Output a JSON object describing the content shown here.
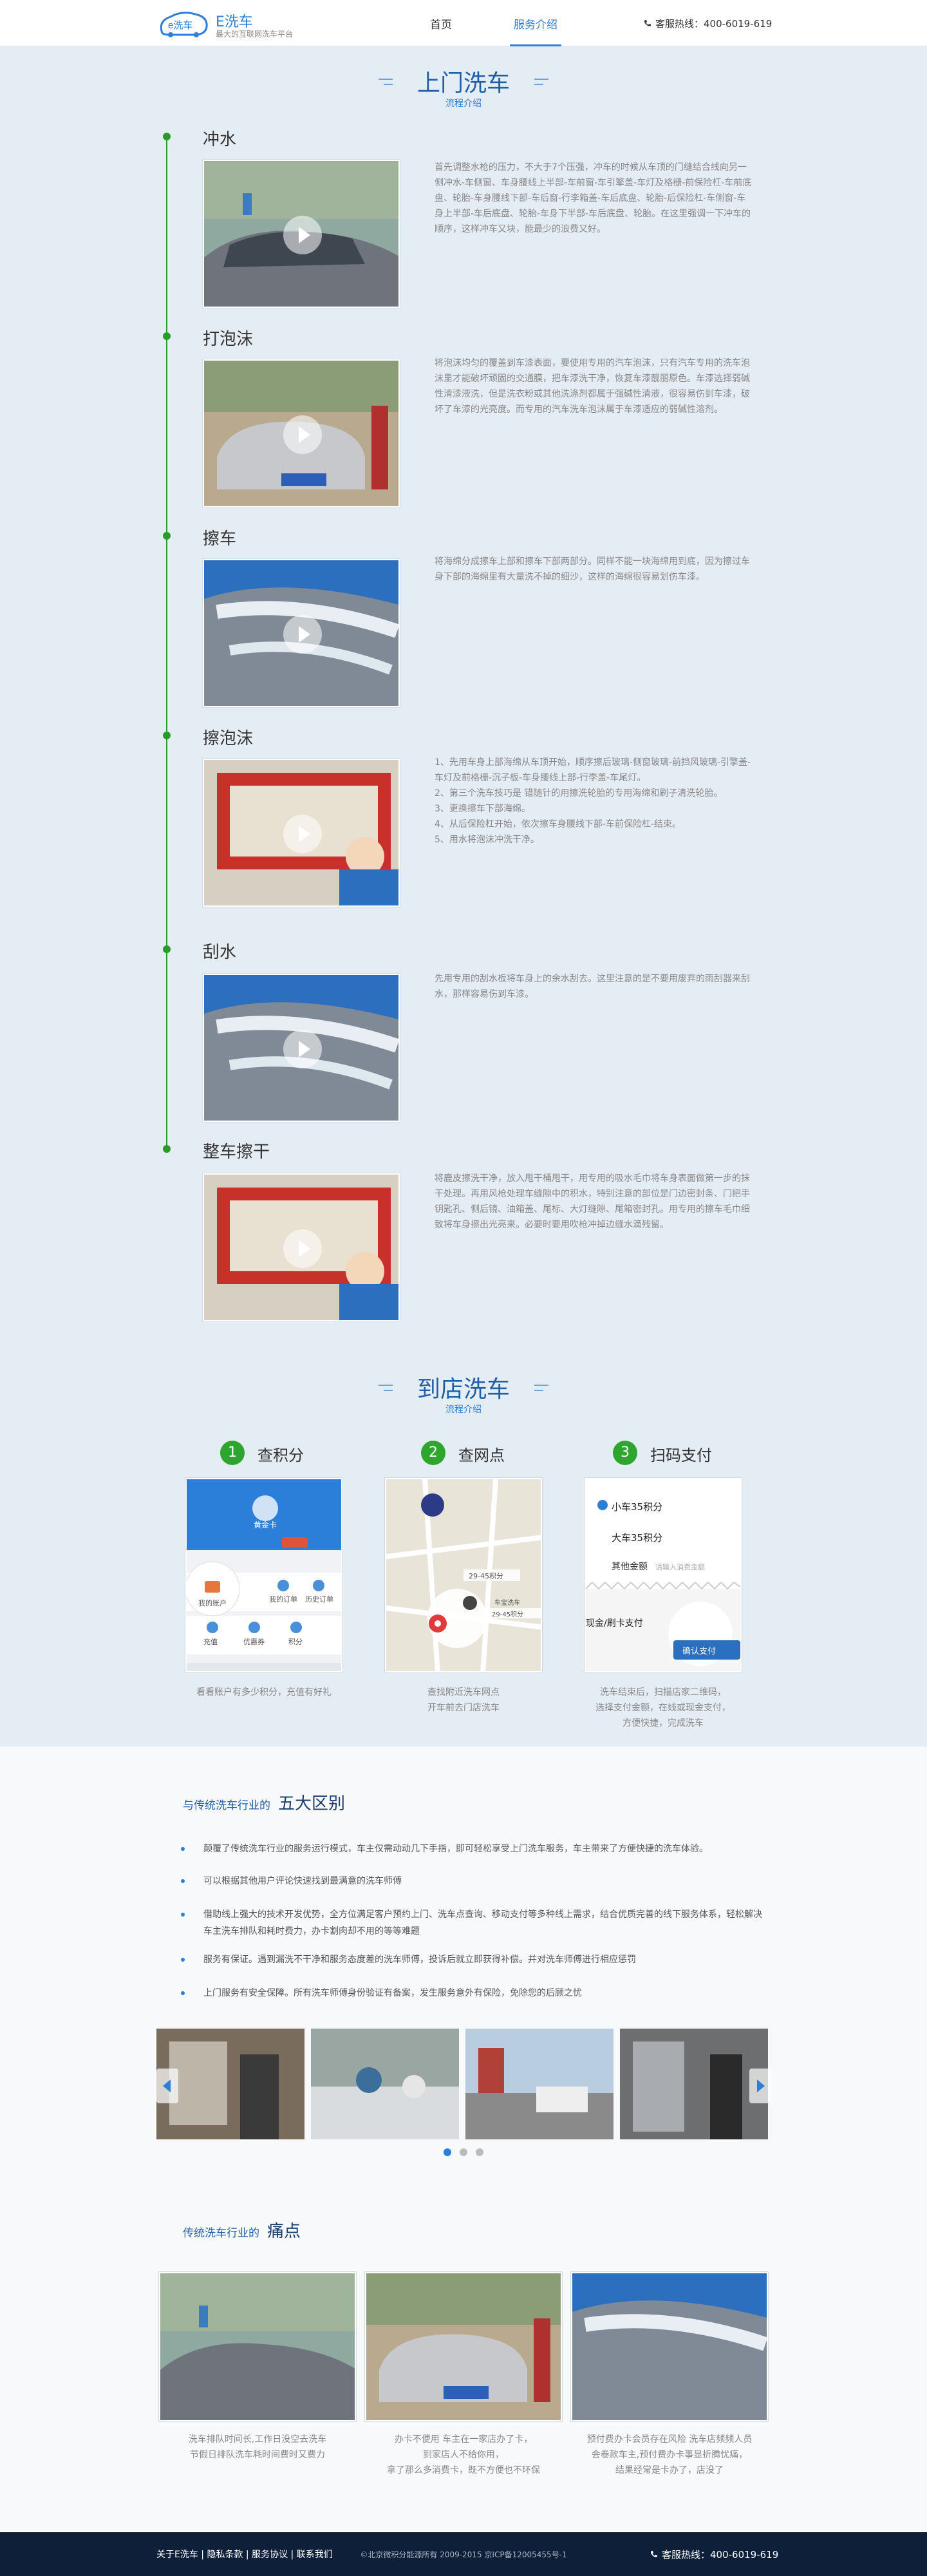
{
  "header": {
    "logo_text": "E洗车",
    "logo_mark": "e洗车",
    "logo_sub": "最大的互联网洗车平台",
    "nav_home": "首页",
    "nav_service": "服务介绍",
    "hotline": "客服热线：400-6019-619"
  },
  "door": {
    "title": "上门洗车",
    "sub": "流程介绍",
    "steps": [
      {
        "title": "冲水",
        "desc": "首先调整水枪的压力，不大于7个压强，冲车的时候从车顶的门缝结合线向另一侧冲水-车侧窗、车身腰线上半部-车前窗-车引擎盖-车灯及格栅-前保险杠-车前底盘、轮胎-车身腰线下部-车后窗-行李箱盖-车后底盘、轮胎-后保险杠-车侧窗-车身上半部-车后底盘、轮胎-车身下半部-车后底盘、轮胎。在这里强调一下冲车的顺序，这样冲车又块，能最少的浪费又好。"
      },
      {
        "title": "打泡沫",
        "desc": "将泡沫均匀的覆盖到车漆表面，要使用专用的汽车泡沫，只有汽车专用的洗车泡沫里才能破坏顽固的交通膜，把车漆洗干净，恢复车漆靓丽原色。车漆选择弱碱性清漆液洗，但是洗衣粉或其他洗涤剂都属于强碱性清液，很容易伤到车漆，破坏了车漆的光亮度。而专用的汽车洗车泡沫属于车漆适应的弱碱性溶剂。"
      },
      {
        "title": "擦车",
        "desc": "将海绵分成擦车上部和擦车下部两部分。同样不能一块海绵用到底，因为擦过车身下部的海绵里有大量洗不掉的细沙，这样的海绵很容易划伤车漆。"
      },
      {
        "title": "擦泡沫",
        "desc": "1、先用车身上部海绵从车顶开始，顺序擦后玻璃-侧窗玻璃-前挡风玻璃-引擎盖-车灯及前格栅-沉子板-车身腰线上部-行李盖-车尾灯。\n2、第三个洗车技巧是 错随针的用擦洗轮胎的专用海绵和刷子清洗轮胎。\n3、更换擦车下部海绵。\n4、从后保险杠开始，依次擦车身腰线下部-车前保险杠-结束。\n5、用水将泡沫冲洗干净。"
      },
      {
        "title": "刮水",
        "desc": "先用专用的刮水板将车身上的余水刮去。这里注意的是不要用废弃的雨刮器来刮水，那样容易伤到车漆。"
      },
      {
        "title": "整车擦干",
        "desc": "将鹿皮擦洗干净，放入甩干桶甩干，用专用的吸水毛巾将车身表面做第一步的抹干处理。再用风枪处理车缝隙中的积水，特别注意的部位是门边密封条、门把手钥匙孔、侧后镜、油箱盖、尾标、大灯缝隙、尾箱密封孔。用专用的擦车毛巾细致将车身擦出光亮来。必要时要用吹枪冲掉边缝水滴残留。"
      }
    ]
  },
  "store": {
    "title": "到店洗车",
    "sub": "流程介绍",
    "cards": [
      {
        "num": "1",
        "title": "查积分",
        "cap": "看看账户有多少积分，充值有好礼",
        "tags": [
          "我的账户",
          "黄金卡",
          "我的订单",
          "历史订单",
          "充值",
          "优惠券",
          "积分"
        ]
      },
      {
        "num": "2",
        "title": "查网点",
        "cap": "查找附近洗车网点\n开车前去门店洗车",
        "tags": [
          "29-45积分",
          "29-45积分",
          "车宝洗车"
        ]
      },
      {
        "num": "3",
        "title": "扫码支付",
        "cap": "洗车结束后，扫描店家二维码，\n选择支付金额，在线或现金支付，\n方便快捷，完成洗车",
        "tags": [
          "小车35积分",
          "大车35积分",
          "其他金额",
          "请输入消费金额",
          "现金/刷卡支付",
          "确认支付"
        ]
      }
    ]
  },
  "diff": {
    "small": "与传统洗车行业的",
    "big": "五大区别",
    "items": [
      "颠覆了传统洗车行业的服务运行模式，车主仅需动动几下手指，即可轻松享受上门洗车服务，车主带来了方便快捷的洗车体验。",
      "可以根据其他用户评论快速找到最满意的洗车师傅",
      "借助线上强大的技术开发优势，全方位满足客户预约上门、洗车点查询、移动支付等多种线上需求，结合优质完善的线下服务体系，轻松解决车主洗车排队和耗时费力，办卡割肉却不用的等等难题",
      "服务有保证。遇到漏洗不干净和服务态度差的洗车师傅，投诉后就立即获得补偿。并对洗车师傅进行相应惩罚",
      "上门服务有安全保障。所有洗车师傅身份验证有备案，发生服务意外有保险，免除您的后顾之忧"
    ]
  },
  "pain": {
    "small": "传统洗车行业的",
    "big": "痛点",
    "items": [
      "洗车排队时间长,工作日没空去洗车\n节假日排队洗车耗时间费时又费力",
      "办卡不便用 车主在一家店办了卡，\n到家店人不给你用，\n拿了那么多消费卡，既不方便也不环保",
      "预付费办卡会员存在风险 洗车店频频人员\n会卷款车主,预付费办卡事显折腾忧痛，\n结果经常是卡办了，店没了"
    ]
  },
  "footer": {
    "links": "关于E洗车 | 隐私条款 | 服务协议 | 联系我们",
    "copy": "©北京微积分能源所有 2009-2015 京ICP备12005455号-1",
    "hotline": "客服热线：400-6019-619"
  },
  "colors": {
    "brand": "#2b7fd8",
    "green": "#2ea52e",
    "navy": "#0e1f3a"
  }
}
